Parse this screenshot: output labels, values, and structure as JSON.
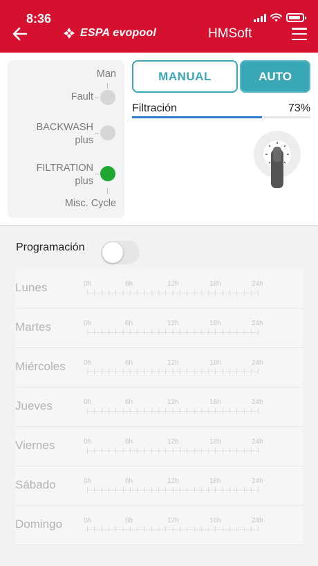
{
  "status_bar": {
    "time": "8:36"
  },
  "header": {
    "brand_espa": "ESPA",
    "brand_evo": "evopool",
    "app_name": "HMSoft"
  },
  "status_panel": {
    "man_label": "Man",
    "fault_label": "Fault",
    "backwash_label": "BACKWASH",
    "backwash_plus": "plus",
    "filtration_label": "FILTRATION",
    "filtration_plus": "plus",
    "misc_label": "Misc. Cycle"
  },
  "mode": {
    "manual_label": "MANUAL",
    "auto_label": "AUTO",
    "selected": "AUTO"
  },
  "filtration": {
    "label": "Filtración",
    "value_text": "73%",
    "percent": 73
  },
  "schedule": {
    "label": "Programación",
    "enabled": false,
    "hour_labels": [
      "0h",
      "6h",
      "12h",
      "18h",
      "24h"
    ],
    "days": [
      "Lunes",
      "Martes",
      "Miércoles",
      "Jueves",
      "Viernes",
      "Sábado",
      "Domingo"
    ]
  },
  "colors": {
    "brand_red": "#d6102f",
    "teal": "#38a7b6",
    "green_indicator": "#1ea832",
    "progress_blue": "#2f7bd0"
  }
}
